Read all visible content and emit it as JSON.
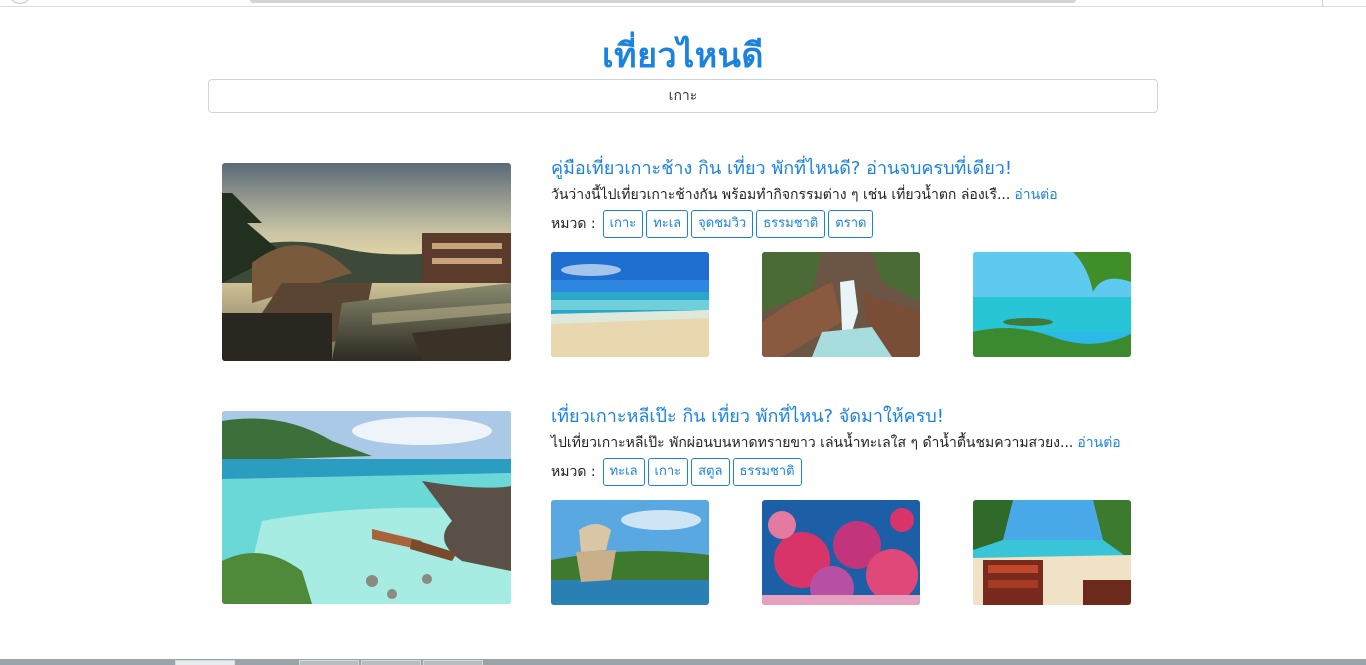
{
  "site": {
    "title": "เที่ยวไหนดี"
  },
  "search": {
    "value": "เกาะ"
  },
  "articles": [
    {
      "title": "คู่มือเที่ยวเกาะช้าง กิน เที่ยว พักที่ไหนดี? อ่านจบครบที่เดียว!",
      "excerpt": "วันว่างนี้ไปเที่ยวเกาะช้างกัน พร้อมทำกิจกรรมต่าง ๆ เช่น เที่ยวน้ำตก ล่องเรื...",
      "read_more": "อ่านต่อ",
      "category_label": "หมวด :",
      "tags": [
        "เกาะ",
        "ทะเล",
        "จุดชมวิว",
        "ธรรมชาติ",
        "ตราด"
      ]
    },
    {
      "title": "เที่ยวเกาะหลีเป๊ะ กิน เที่ยว พักที่ไหน? จัดมาให้ครบ!",
      "excerpt": "ไปเที่ยวเกาะหลีเป๊ะ พักผ่อนบนหาดทรายขาว เล่นน้ำทะเลใส ๆ ดำน้ำตื้นชมความสวยง...",
      "read_more": "อ่านต่อ",
      "category_label": "หมวด :",
      "tags": [
        "ทะเล",
        "เกาะ",
        "สตูล",
        "ธรรมชาติ"
      ]
    }
  ],
  "colors": {
    "accent": "#1a83e0"
  }
}
